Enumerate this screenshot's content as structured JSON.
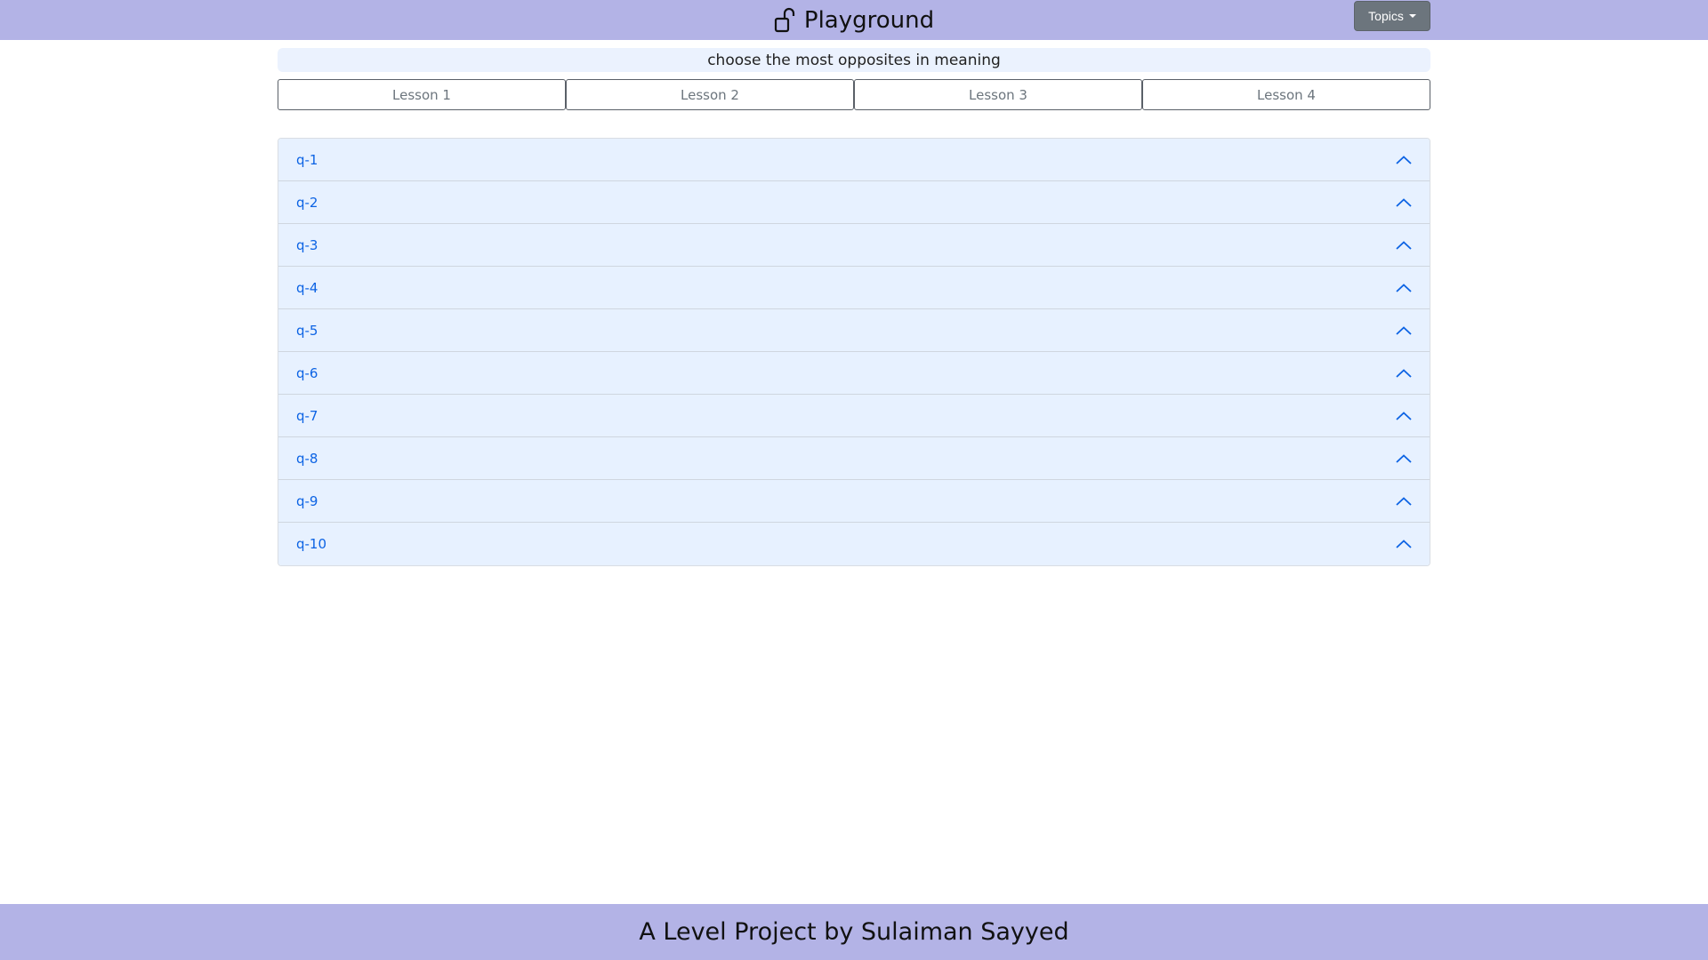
{
  "header": {
    "brand_icon": "unlock-icon",
    "brand_title": "Playground",
    "topics_button": "Topics",
    "background": "#b3b3e6"
  },
  "instruction": "choose the most opposites in meaning",
  "lessons": [
    {
      "label": "Lesson 1"
    },
    {
      "label": "Lesson 2"
    },
    {
      "label": "Lesson 3"
    },
    {
      "label": "Lesson 4"
    }
  ],
  "questions": [
    {
      "label": "q-1",
      "icon": "chevron-up-icon"
    },
    {
      "label": "q-2",
      "icon": "chevron-up-icon"
    },
    {
      "label": "q-3",
      "icon": "chevron-up-icon"
    },
    {
      "label": "q-4",
      "icon": "chevron-up-icon"
    },
    {
      "label": "q-5",
      "icon": "chevron-up-icon"
    },
    {
      "label": "q-6",
      "icon": "chevron-up-icon"
    },
    {
      "label": "q-7",
      "icon": "chevron-up-icon"
    },
    {
      "label": "q-8",
      "icon": "chevron-up-icon"
    },
    {
      "label": "q-9",
      "icon": "chevron-up-icon"
    },
    {
      "label": "q-10",
      "icon": "chevron-up-icon"
    }
  ],
  "footer": {
    "text": "A Level Project by Sulaiman Sayyed"
  },
  "colors": {
    "accent": "#0c63e4",
    "accordion_bg": "#e7f1ff",
    "topics_button_bg": "#6c757d"
  }
}
